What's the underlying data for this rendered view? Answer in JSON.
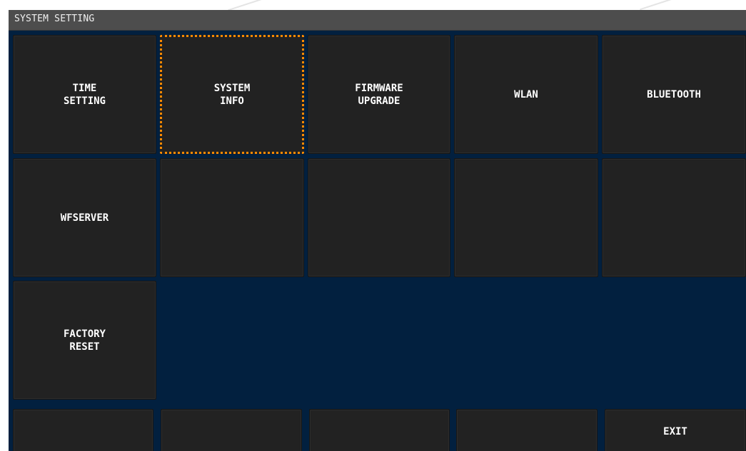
{
  "screen": {
    "title": "SYSTEM SETTING"
  },
  "colors": {
    "background": "#02203f",
    "titlebar": "#4d4d4d",
    "tile": "#222222",
    "selection": "#ff8a00",
    "text": "#ffffff"
  },
  "tiles": {
    "time_setting": "TIME\nSETTING",
    "system_info": "SYSTEM\nINFO",
    "firmware_upgrade": "FIRMWARE\nUPGRADE",
    "wlan": "WLAN",
    "bluetooth": "BLUETOOTH",
    "wfserver": "WFSERVER",
    "factory_reset": "FACTORY\nRESET"
  },
  "footer": {
    "exit_label": "EXIT"
  }
}
